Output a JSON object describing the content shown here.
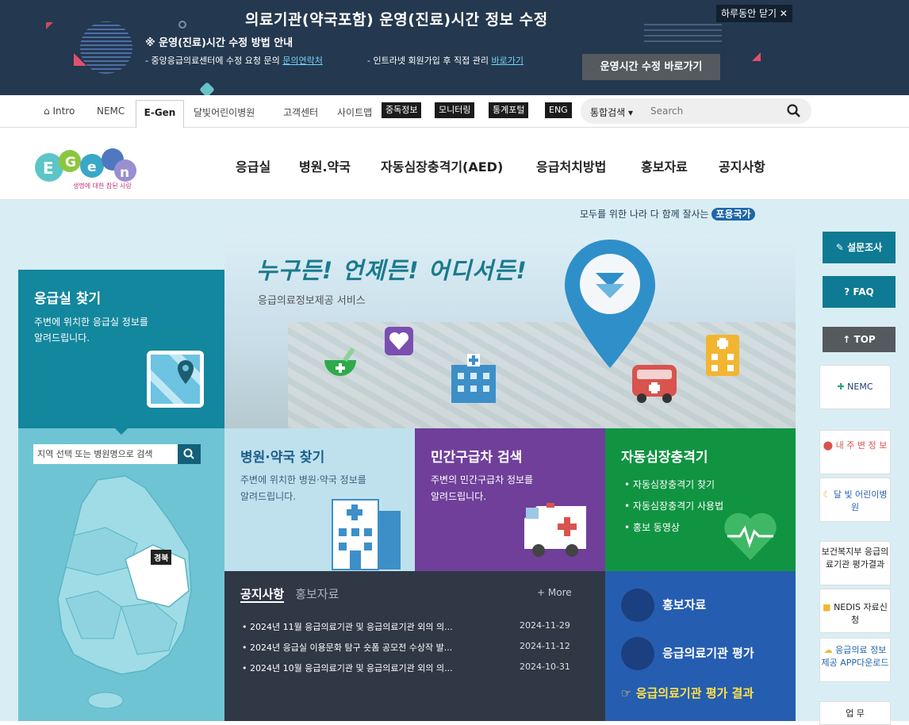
{
  "banner": {
    "title": "의료기관(약국포함) 운영(진료)시간 정보 수정",
    "subtitle": "※ 운영(진료)시간 수정 방법 안내",
    "method1": "- 중앙응급의료센터에 수정 요청 문의",
    "method1_link": "문의연락처",
    "method2": "- 인트라넷 회원가입 후 직접 관리",
    "method2_link": "바로가기",
    "close_label": "하루동안 닫기",
    "go_label": "운영시간 수정 바로가기"
  },
  "util_nav": {
    "intro": "Intro",
    "nemc": "NEMC",
    "egen": "E-Gen",
    "moon": "달빛어린이병원",
    "customer": "고객센터",
    "sitemap": "사이트맵",
    "black_buttons": [
      "중독정보",
      "모니터링",
      "통계포털",
      "ENG"
    ],
    "search_scope": "통합검색",
    "search_placeholder": "Search"
  },
  "header": {
    "logo_sub": "생명에 대한 참된 사랑",
    "menu": [
      "응급실",
      "병원.약국",
      "자동심장충격기(AED)",
      "응급처치방법",
      "홍보자료",
      "공지사항"
    ]
  },
  "slogan": {
    "text": "모두를 위한 나라 다 함께 잘사는",
    "badge": "포용국가"
  },
  "hero": {
    "headline": "누구든! 언제든! 어디서든!",
    "subline": "응급의료정보제공 서비스"
  },
  "er": {
    "title": "응급실 찾기",
    "desc1": "주변에 위치한 응급실 정보를",
    "desc2": "알려드립니다."
  },
  "side": {
    "search_placeholder": "지역 선택 또는 병원명으로 검색",
    "selected_region": "경북"
  },
  "tiles": {
    "hospital": {
      "title": "병원·약국 찾기",
      "desc1": "주변에 위치한 병원·약국 정보를",
      "desc2": "알려드립니다."
    },
    "ambulance": {
      "title": "민간구급차 검색",
      "desc1": "주변의 민간구급차 정보를",
      "desc2": "알려드립니다."
    },
    "aed": {
      "title": "자동심장충격기",
      "items": [
        "자동심장충격기 찾기",
        "자동심장충격기 사용법",
        "홍보 동영상"
      ]
    }
  },
  "news": {
    "tab_active": "공지사항",
    "tab_other": "홍보자료",
    "more": "+ More",
    "items": [
      {
        "title": "2024년 11월 응급의료기관 및 응급의료기관 외의 의...",
        "date": "2024-11-29"
      },
      {
        "title": "2024년 응급실 이용문화 탐구 숏폼 공모전 수상작 발...",
        "date": "2024-11-12"
      },
      {
        "title": "2024년 10월 응급의료기관 및 응급의료기관 외의 의...",
        "date": "2024-10-31"
      }
    ]
  },
  "promo": {
    "item1": "홍보자료",
    "item2": "응급의료기관 평가",
    "result": "응급의료기관 평가 결과"
  },
  "rail": {
    "survey": "설문조사",
    "faq": "FAQ",
    "top": "TOP",
    "banners": [
      "NEMC",
      "내 주 변 정 보",
      "달 빛 어린이병원",
      "보건복지부 응급의료기관 평가결과",
      "NEDIS 자료신청",
      "응급의료 정보제공 APP다운로드",
      "업 무"
    ]
  },
  "colors": {
    "teal": "#13879d",
    "navy": "#24384f",
    "purple": "#6f3f9a",
    "green": "#109442",
    "blue": "#255db0",
    "dark": "#303845"
  }
}
